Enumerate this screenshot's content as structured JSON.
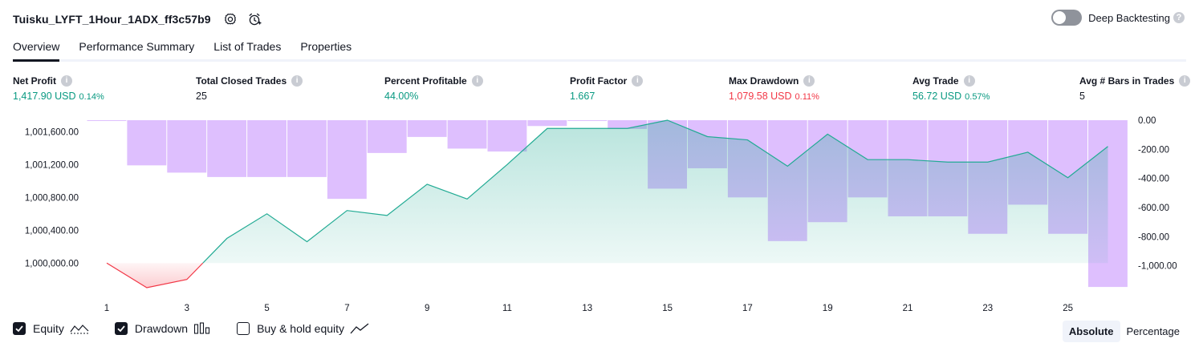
{
  "header": {
    "strategy_title": "Tuisku_LYFT_1Hour_1ADX_ff3c57b9",
    "deep_backtesting_label": "Deep Backtesting",
    "help_mark": "?"
  },
  "tabs": [
    {
      "label": "Overview",
      "active": true
    },
    {
      "label": "Performance Summary",
      "active": false
    },
    {
      "label": "List of Trades",
      "active": false
    },
    {
      "label": "Properties",
      "active": false
    }
  ],
  "metrics": [
    {
      "label": "Net Profit",
      "value": "1,417.90 USD",
      "pct": "0.14%",
      "color": "#089981"
    },
    {
      "label": "Total Closed Trades",
      "value": "25",
      "pct": "",
      "color": "#131722"
    },
    {
      "label": "Percent Profitable",
      "value": "44.00%",
      "pct": "",
      "color": "#089981"
    },
    {
      "label": "Profit Factor",
      "value": "1.667",
      "pct": "",
      "color": "#089981"
    },
    {
      "label": "Max Drawdown",
      "value": "1,079.58 USD",
      "pct": "0.11%",
      "color": "#f23645"
    },
    {
      "label": "Avg Trade",
      "value": "56.72 USD",
      "pct": "0.57%",
      "color": "#089981"
    },
    {
      "label": "Avg # Bars in Trades",
      "value": "5",
      "pct": "",
      "color": "#131722"
    }
  ],
  "chart_data": {
    "type": "line",
    "x": [
      1,
      2,
      3,
      4,
      5,
      6,
      7,
      8,
      9,
      10,
      11,
      12,
      13,
      14,
      15,
      16,
      17,
      18,
      19,
      20,
      21,
      22,
      23,
      24,
      25,
      26
    ],
    "x_ticks": [
      "1",
      "3",
      "5",
      "7",
      "9",
      "11",
      "13",
      "15",
      "17",
      "19",
      "21",
      "23",
      "25"
    ],
    "y_left_ticks": [
      "1,000,000.00",
      "1,000,400.00",
      "1,000,800.00",
      "1,001,200.00",
      "1,001,600.00"
    ],
    "y_right_ticks": [
      "0.00",
      "-200.00",
      "-400.00",
      "-600.00",
      "-800.00",
      "-1,000.00"
    ],
    "ylim_left": [
      999700,
      1001740
    ],
    "ylim_right": [
      -1150,
      0
    ],
    "series": [
      {
        "name": "Equity",
        "values": [
          1000000,
          999700,
          999800,
          1000300,
          1000600,
          1000260,
          1000640,
          1000580,
          1000960,
          1000780,
          1001200,
          1001640,
          1001640,
          1001640,
          1001740,
          1001540,
          1001500,
          1001180,
          1001570,
          1001260,
          1001260,
          1001230,
          1001230,
          1001350,
          1001040,
          1001420
        ]
      },
      {
        "name": "Drawdown",
        "values": [
          0,
          -310,
          -360,
          -390,
          -390,
          -390,
          -540,
          -225,
          -115,
          -195,
          -215,
          -40,
          0,
          -60,
          -470,
          -330,
          -530,
          -830,
          -700,
          -530,
          -660,
          -660,
          -780,
          -580,
          -780,
          -1145
        ]
      }
    ],
    "equity_color": "#22ab94",
    "equity_negative_color": "#f23645",
    "drawdown_color": "#d8b4fe"
  },
  "legend": [
    {
      "label": "Equity",
      "checked": true,
      "icon": "equity-line-icon"
    },
    {
      "label": "Drawdown",
      "checked": true,
      "icon": "drawdown-bars-icon"
    },
    {
      "label": "Buy & hold equity",
      "checked": false,
      "icon": "buy-hold-line-icon"
    }
  ],
  "mode": {
    "absolute_label": "Absolute",
    "percentage_label": "Percentage",
    "selected": "Absolute"
  }
}
